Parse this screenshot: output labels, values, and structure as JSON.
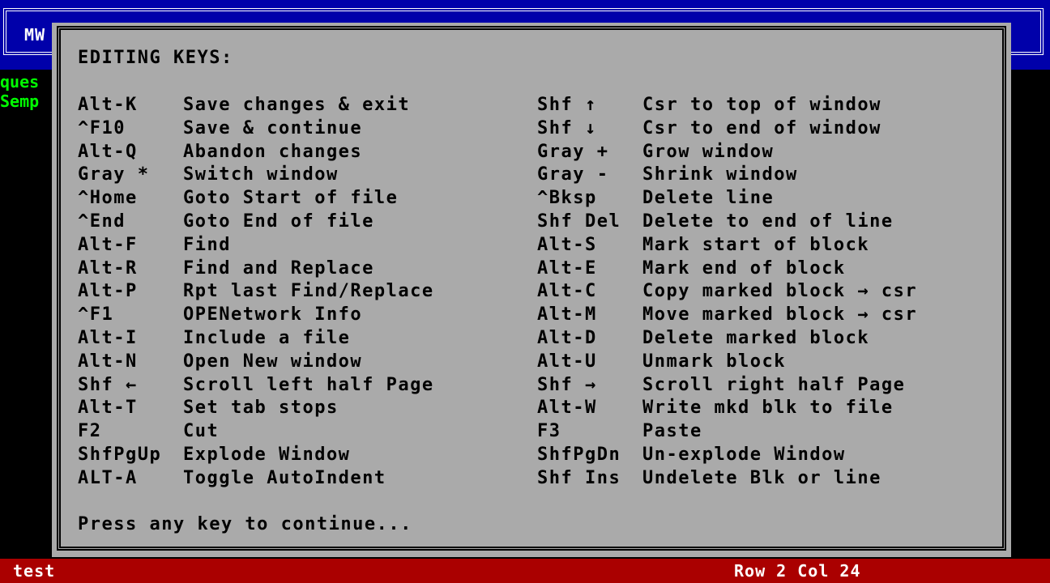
{
  "window": {
    "title": "MW"
  },
  "background_text": {
    "lines": [
      "ques",
      "Semp"
    ]
  },
  "dialog": {
    "heading": "EDITING KEYS:",
    "footer": "Press any key to continue...",
    "left_bindings": [
      {
        "key": "Alt-K",
        "desc": "Save changes & exit"
      },
      {
        "key": "^F10",
        "desc": "Save & continue"
      },
      {
        "key": "Alt-Q",
        "desc": "Abandon changes"
      },
      {
        "key": "Gray *",
        "desc": "Switch window"
      },
      {
        "key": "^Home",
        "desc": "Goto Start of file"
      },
      {
        "key": "^End",
        "desc": "Goto End of file"
      },
      {
        "key": "Alt-F",
        "desc": "Find"
      },
      {
        "key": "Alt-R",
        "desc": "Find and Replace"
      },
      {
        "key": "Alt-P",
        "desc": "Rpt last Find/Replace"
      },
      {
        "key": "^F1",
        "desc": "OPENetwork Info"
      },
      {
        "key": "Alt-I",
        "desc": "Include a file"
      },
      {
        "key": "Alt-N",
        "desc": "Open New window"
      },
      {
        "key": "Shf ←",
        "desc": "Scroll left half Page"
      },
      {
        "key": "Alt-T",
        "desc": "Set tab stops"
      },
      {
        "key": "F2",
        "desc": "Cut"
      },
      {
        "key": "ShfPgUp",
        "desc": "Explode Window"
      },
      {
        "key": "ALT-A",
        "desc": "Toggle AutoIndent"
      }
    ],
    "right_bindings": [
      {
        "key": "Shf ↑",
        "desc": "Csr to top of window"
      },
      {
        "key": "Shf ↓",
        "desc": "Csr to end of window"
      },
      {
        "key": "Gray +",
        "desc": "Grow window"
      },
      {
        "key": "Gray -",
        "desc": "Shrink window"
      },
      {
        "key": "^Bksp",
        "desc": "Delete line"
      },
      {
        "key": "Shf Del",
        "desc": "Delete to end of line"
      },
      {
        "key": "Alt-S",
        "desc": "Mark start of block"
      },
      {
        "key": "Alt-E",
        "desc": "Mark end of block"
      },
      {
        "key": "Alt-C",
        "desc": "Copy marked block → csr"
      },
      {
        "key": "Alt-M",
        "desc": "Move marked block → csr"
      },
      {
        "key": "Alt-D",
        "desc": "Delete marked block"
      },
      {
        "key": "Alt-U",
        "desc": "Unmark block"
      },
      {
        "key": "Shf →",
        "desc": "Scroll right half Page"
      },
      {
        "key": "Alt-W",
        "desc": "Write mkd blk to file"
      },
      {
        "key": "F3",
        "desc": "Paste"
      },
      {
        "key": "ShfPgDn",
        "desc": "Un-explode Window"
      },
      {
        "key": "Shf Ins",
        "desc": "Undelete Blk or line"
      }
    ]
  },
  "status_bar": {
    "filename": "test",
    "position": "Row 2 Col 24"
  },
  "colors": {
    "top_bar": "#0000aa",
    "dialog_bg": "#aaaaaa",
    "status_bar": "#aa0000",
    "background_text": "#00ff00"
  }
}
